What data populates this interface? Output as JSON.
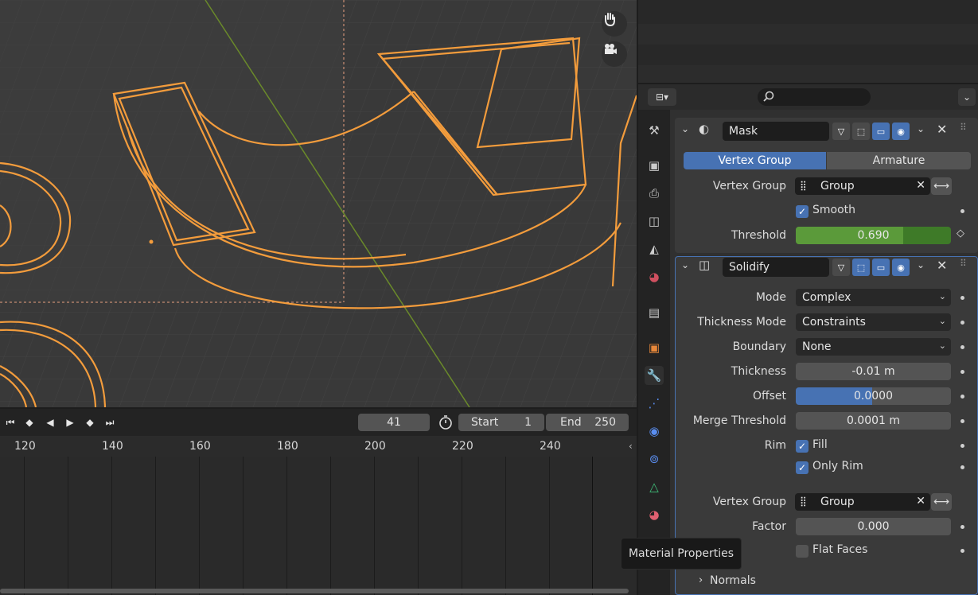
{
  "timeline": {
    "current_frame": "41",
    "start_label": "Start",
    "start_value": "1",
    "end_label": "End",
    "end_value": "250",
    "ticks": [
      "120",
      "140",
      "160",
      "180",
      "200",
      "220",
      "240"
    ]
  },
  "properties": {
    "mask": {
      "name": "Mask",
      "mode_tabs": [
        "Vertex Group",
        "Armature"
      ],
      "vertex_group_label": "Vertex Group",
      "vertex_group_value": "Group",
      "smooth_label": "Smooth",
      "threshold_label": "Threshold",
      "threshold_value": "0.690",
      "threshold_fraction": 0.69
    },
    "solidify": {
      "name": "Solidify",
      "mode_label": "Mode",
      "mode_value": "Complex",
      "thickness_mode_label": "Thickness Mode",
      "thickness_mode_value": "Constraints",
      "boundary_label": "Boundary",
      "boundary_value": "None",
      "thickness_label": "Thickness",
      "thickness_value": "-0.01 m",
      "offset_label": "Offset",
      "offset_value": "0.0000",
      "merge_label": "Merge Threshold",
      "merge_value": "0.0001 m",
      "rim_label": "Rim",
      "fill_label": "Fill",
      "only_rim_label": "Only Rim",
      "vertex_group_label": "Vertex Group",
      "vertex_group_value": "Group",
      "factor_label": "Factor",
      "factor_value": "0.000",
      "flat_faces_label": "Flat Faces",
      "normals_label": "Normals"
    }
  },
  "tooltip": "Material Properties",
  "colors": {
    "accent_blue": "#4772b3",
    "threshold_green": "#5b9a3a",
    "selection_orange": "#f39c3c"
  }
}
